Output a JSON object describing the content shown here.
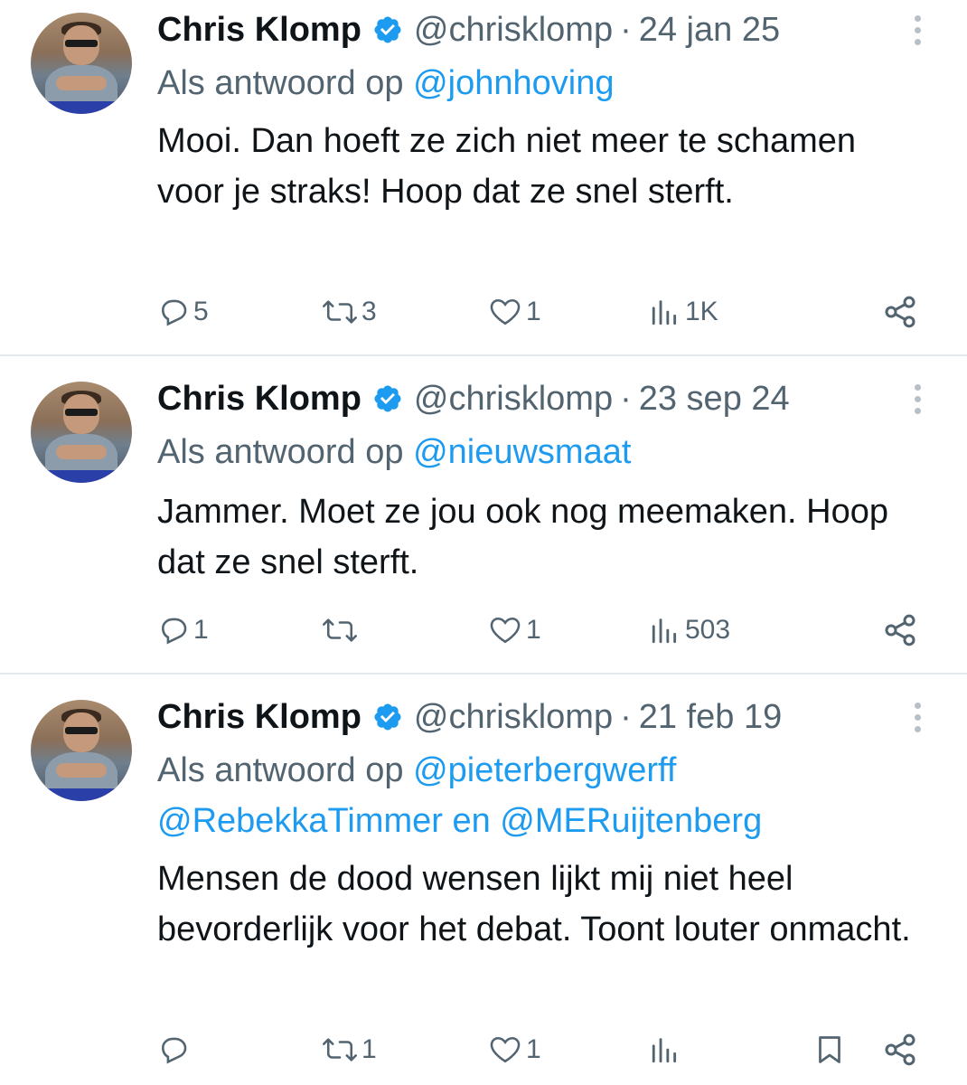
{
  "tweets": [
    {
      "name": "Chris Klomp",
      "handle": "@chrisklomp",
      "sep": "·",
      "date": "24 jan 25",
      "reply_prefix": "Als antwoord op ",
      "reply_line1": "@johnhoving",
      "reply_line2": "",
      "text": "Mooi. Dan hoeft ze zich niet meer te schamen voor je straks! Hoop dat ze snel sterft.",
      "replies": "5",
      "reposts": "3",
      "likes": "1",
      "views": "1K"
    },
    {
      "name": "Chris Klomp",
      "handle": "@chrisklomp",
      "sep": "·",
      "date": "23 sep 24",
      "reply_prefix": "Als antwoord op ",
      "reply_line1": "@nieuwsmaat",
      "reply_line2": "",
      "text": "Jammer. Moet ze jou ook nog meemaken. Hoop dat ze snel sterft.",
      "replies": "1",
      "reposts": "",
      "likes": "1",
      "views": "503"
    },
    {
      "name": "Chris Klomp",
      "handle": "@chrisklomp",
      "sep": "·",
      "date": "21 feb 19",
      "reply_prefix": "Als antwoord op ",
      "reply_line1": "@pieterbergwerff",
      "reply_line2_a": "@RebekkaTimmer",
      "reply_line2_en": " en ",
      "reply_line2_b": "@MERuijtenberg",
      "text": "Mensen de dood wensen lijkt mij niet heel bevorderlijk voor het debat. Toont louter onmacht.",
      "replies": "",
      "reposts": "1",
      "likes": "1",
      "views": ""
    }
  ],
  "icons": {
    "reply": "reply-icon",
    "repost": "repost-icon",
    "like": "heart-icon",
    "views": "views-icon",
    "share": "share-icon",
    "bookmark": "bookmark-icon",
    "verified": "verified-badge-icon",
    "more": "more-icon"
  },
  "colors": {
    "text": "#0f1419",
    "secondary": "#536471",
    "link": "#1d9bf0",
    "divider": "#e6e9ec"
  }
}
